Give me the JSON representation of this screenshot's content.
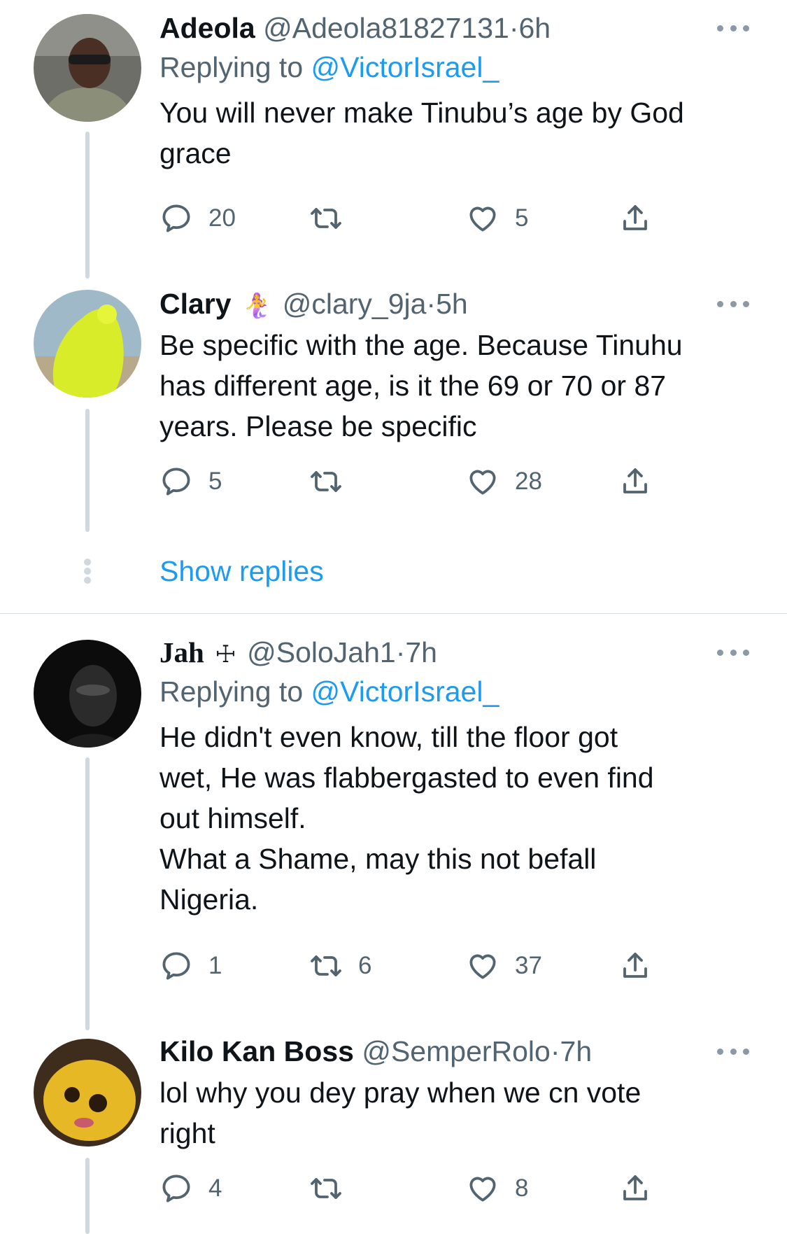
{
  "tweets": [
    {
      "name": "Adeola",
      "handle": "@Adeola81827131",
      "dot": "·",
      "time": "6h",
      "replying_prefix": "Replying to ",
      "replying_to": "@VictorIsrael_",
      "text": "You will never make Tinubu’s age by God\ngrace",
      "replies": "20",
      "retweets": "",
      "likes": "5"
    },
    {
      "name": "Clary",
      "badge": "🧜‍♀️",
      "handle": "@clary_9ja",
      "dot": "·",
      "time": "5h",
      "text": "Be specific with the age. Because Tinuhu\nhas different age, is it the 69 or 70 or 87\nyears. Please be specific",
      "replies": "5",
      "retweets": "",
      "likes": "28"
    },
    {
      "name": "Jah",
      "badge": "☩",
      "handle": "@SoloJah1",
      "dot": "·",
      "time": "7h",
      "replying_prefix": "Replying to ",
      "replying_to": "@VictorIsrael_",
      "text": "He didn't even know, till the floor got\nwet, He was flabbergasted to even find\nout himself.\nWhat a Shame, may this not befall\nNigeria.",
      "replies": "1",
      "retweets": "6",
      "likes": "37"
    },
    {
      "name": "Kilo Kan Boss",
      "handle": "@SemperRolo",
      "dot": "·",
      "time": "7h",
      "text": "lol why you dey pray when we cn vote\nright",
      "replies": "4",
      "retweets": "",
      "likes": "8"
    }
  ],
  "show_replies": "Show replies",
  "icons": {
    "reply": "reply-icon",
    "retweet": "retweet-icon",
    "like": "heart-icon",
    "share": "share-icon",
    "more": "more-icon"
  },
  "colors": {
    "link": "#1d9bf0",
    "secondary_text": "#536471",
    "primary_text": "#0f1419",
    "thread_line": "#cfd9de"
  }
}
